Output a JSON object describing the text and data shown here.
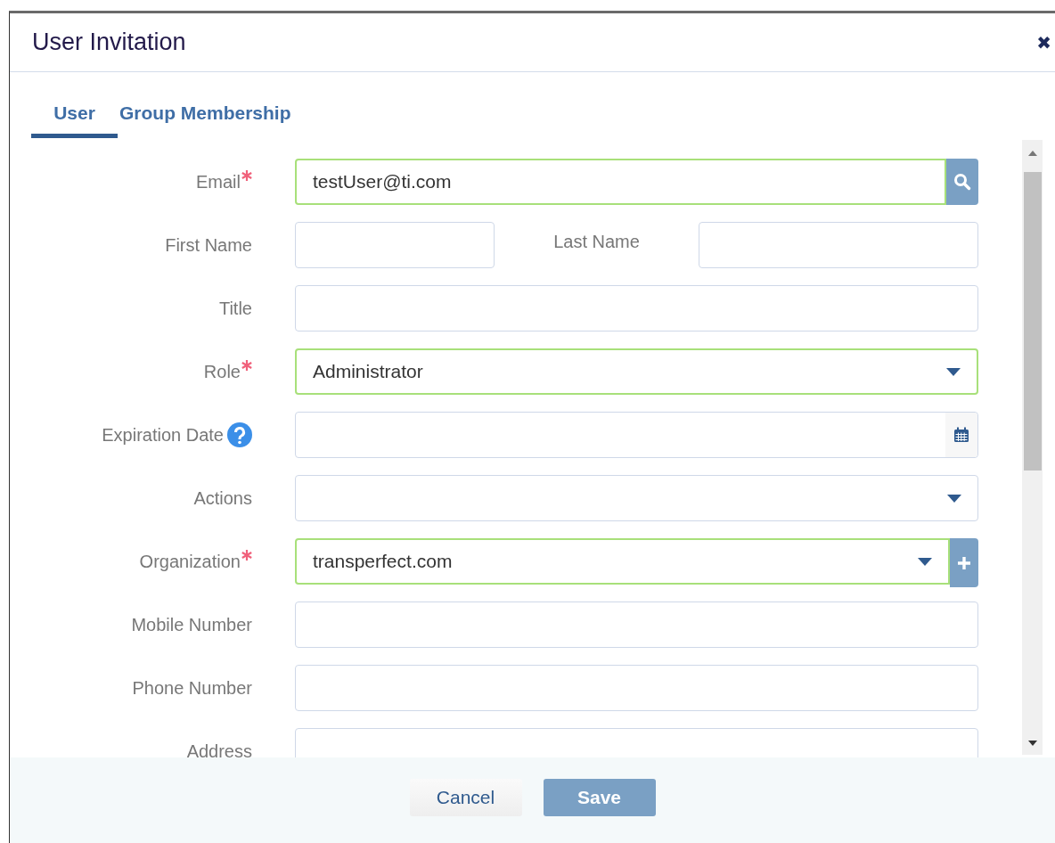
{
  "dialog": {
    "title": "User Invitation",
    "close_icon": "✖"
  },
  "tabs": [
    {
      "label": "User",
      "selected": true
    },
    {
      "label": "Group Membership",
      "selected": false
    }
  ],
  "fields": [
    {
      "kind": "lookup",
      "label": "Email",
      "required": true,
      "value": "testUser@ti.com",
      "validated": true
    },
    {
      "kind": "pair",
      "label": "First Name",
      "required": false,
      "validated": false,
      "second_label": "Last Name"
    },
    {
      "kind": "text",
      "label": "Title",
      "required": false,
      "validated": false
    },
    {
      "kind": "select",
      "label": "Role",
      "required": true,
      "value": "Administrator",
      "validated": true
    },
    {
      "kind": "date",
      "label": "Expiration Date",
      "required": false,
      "help": true,
      "validated": false
    },
    {
      "kind": "select",
      "label": "Actions",
      "required": false,
      "validated": false
    },
    {
      "kind": "select_add",
      "label": "Organization",
      "required": true,
      "value": "transperfect.com",
      "validated": true
    },
    {
      "kind": "text",
      "label": "Mobile Number",
      "required": false,
      "validated": false
    },
    {
      "kind": "text",
      "label": "Phone Number",
      "required": false,
      "validated": false
    },
    {
      "kind": "text",
      "label": "Address",
      "required": false,
      "validated": false
    }
  ],
  "buttons": [
    {
      "label": "Cancel",
      "kind": "secondary"
    },
    {
      "label": "Save",
      "kind": "primary"
    }
  ]
}
